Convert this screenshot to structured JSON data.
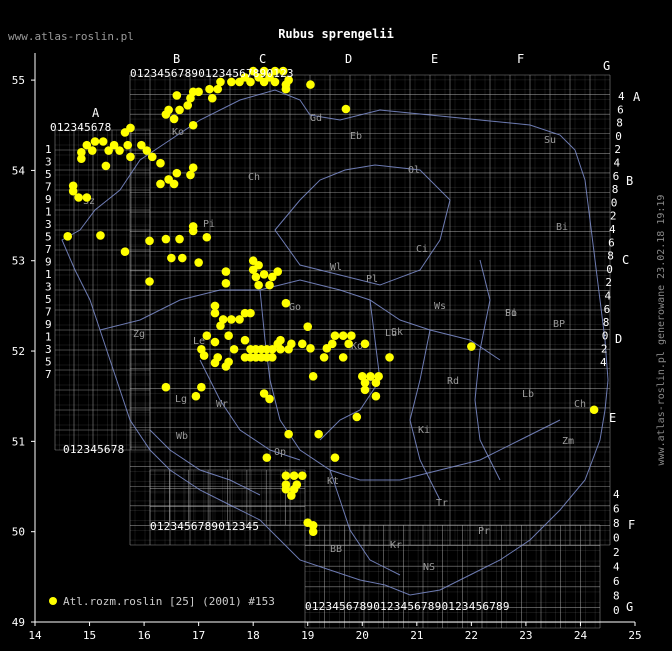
{
  "title": "Rubus sprengelii",
  "site": "www.atlas-roslin.pl",
  "footer": "www.atlas-roslin.pl generowane 23.02.18 19:19",
  "legend": {
    "label": "Atl.rozm.roslin [25] (2001) #153",
    "marker_color": "#ffff00"
  },
  "colors": {
    "background": "#000000",
    "grid": "#b4b4b4",
    "border": "#7f8fd0",
    "point": "#ffff00",
    "axis": "#ffffff",
    "label": "#9a9a9a"
  },
  "axes": {
    "x_ticks": [
      "14",
      "15",
      "16",
      "17",
      "18",
      "19",
      "20",
      "21",
      "22",
      "23",
      "24",
      "25"
    ],
    "y_ticks": [
      "49",
      "50",
      "51",
      "52",
      "53",
      "54",
      "55"
    ],
    "x_range": [
      14,
      25
    ],
    "y_range": [
      49,
      55.3
    ]
  },
  "grid_letters_top": [
    "A",
    "B",
    "C",
    "D",
    "E",
    "F",
    "G"
  ],
  "grid_letters_right": [
    "A",
    "B",
    "C",
    "D",
    "E",
    "F",
    "G"
  ],
  "digit_strip": "0123456789",
  "region_codes": [
    "Gd",
    "Eb",
    "Su",
    "Ol",
    "Ko",
    "Ch",
    "Sz",
    "Bi",
    "Ci",
    "Pi",
    "Wl",
    "Pl",
    "Ws",
    "Go",
    "Po",
    "Lu",
    "Sk",
    "Si",
    "BP",
    "Zg",
    "Le",
    "Ko",
    "Rd",
    "Lb",
    "Ch",
    "Lg",
    "Wr",
    "Cz",
    "Ki",
    "Zm",
    "Wb",
    "Op",
    "Kt",
    "Tr",
    "Pr",
    "NS",
    "BB",
    "Kr"
  ],
  "chart_data": {
    "type": "scatter",
    "xlabel": "",
    "ylabel": "",
    "xlim": [
      14,
      25
    ],
    "ylim": [
      49,
      55.3
    ],
    "series": [
      {
        "name": "Atl.rozm.roslin [25] (2001) #153",
        "points": [
          [
            18.0,
            55.1
          ],
          [
            18.2,
            55.1
          ],
          [
            18.4,
            55.1
          ],
          [
            18.55,
            55.1
          ],
          [
            17.85,
            55.03
          ],
          [
            18.1,
            55.03
          ],
          [
            18.3,
            55.03
          ],
          [
            18.65,
            55.0
          ],
          [
            17.4,
            54.98
          ],
          [
            17.6,
            54.98
          ],
          [
            17.75,
            54.98
          ],
          [
            17.95,
            54.98
          ],
          [
            18.2,
            54.98
          ],
          [
            18.4,
            54.98
          ],
          [
            18.6,
            54.95
          ],
          [
            17.2,
            54.9
          ],
          [
            17.35,
            54.9
          ],
          [
            18.6,
            54.9
          ],
          [
            19.05,
            54.95
          ],
          [
            16.9,
            54.87
          ],
          [
            17.0,
            54.87
          ],
          [
            16.6,
            54.83
          ],
          [
            16.85,
            54.8
          ],
          [
            17.25,
            54.8
          ],
          [
            16.8,
            54.72
          ],
          [
            16.45,
            54.67
          ],
          [
            16.65,
            54.67
          ],
          [
            16.4,
            54.62
          ],
          [
            16.55,
            54.57
          ],
          [
            16.9,
            54.5
          ],
          [
            15.75,
            54.47
          ],
          [
            15.65,
            54.42
          ],
          [
            19.7,
            54.68
          ],
          [
            15.1,
            54.32
          ],
          [
            15.25,
            54.32
          ],
          [
            14.95,
            54.28
          ],
          [
            15.45,
            54.28
          ],
          [
            15.7,
            54.28
          ],
          [
            15.95,
            54.28
          ],
          [
            15.05,
            54.22
          ],
          [
            15.35,
            54.22
          ],
          [
            15.55,
            54.22
          ],
          [
            16.05,
            54.22
          ],
          [
            14.85,
            54.2
          ],
          [
            16.15,
            54.15
          ],
          [
            15.75,
            54.15
          ],
          [
            14.85,
            54.13
          ],
          [
            16.3,
            54.08
          ],
          [
            15.3,
            54.05
          ],
          [
            16.9,
            54.03
          ],
          [
            16.6,
            53.97
          ],
          [
            16.85,
            53.95
          ],
          [
            16.45,
            53.9
          ],
          [
            16.3,
            53.85
          ],
          [
            16.55,
            53.85
          ],
          [
            14.7,
            53.83
          ],
          [
            14.7,
            53.77
          ],
          [
            14.8,
            53.7
          ],
          [
            14.95,
            53.7
          ],
          [
            16.9,
            53.38
          ],
          [
            16.9,
            53.33
          ],
          [
            14.6,
            53.27
          ],
          [
            15.2,
            53.28
          ],
          [
            17.15,
            53.26
          ],
          [
            16.1,
            53.22
          ],
          [
            16.4,
            53.24
          ],
          [
            16.65,
            53.24
          ],
          [
            15.65,
            53.1
          ],
          [
            16.5,
            53.03
          ],
          [
            16.7,
            53.03
          ],
          [
            17.0,
            52.98
          ],
          [
            18.0,
            53.0
          ],
          [
            18.1,
            52.95
          ],
          [
            18.0,
            52.9
          ],
          [
            17.5,
            52.88
          ],
          [
            18.45,
            52.88
          ],
          [
            18.2,
            52.85
          ],
          [
            18.05,
            52.82
          ],
          [
            18.35,
            52.82
          ],
          [
            16.1,
            52.77
          ],
          [
            17.5,
            52.75
          ],
          [
            18.1,
            52.73
          ],
          [
            18.3,
            52.73
          ],
          [
            18.6,
            52.53
          ],
          [
            17.3,
            52.5
          ],
          [
            17.3,
            52.42
          ],
          [
            17.85,
            52.42
          ],
          [
            17.95,
            52.42
          ],
          [
            17.45,
            52.35
          ],
          [
            17.6,
            52.35
          ],
          [
            17.75,
            52.35
          ],
          [
            17.4,
            52.28
          ],
          [
            19.0,
            52.27
          ],
          [
            17.15,
            52.17
          ],
          [
            17.55,
            52.17
          ],
          [
            19.5,
            52.17
          ],
          [
            19.65,
            52.17
          ],
          [
            19.8,
            52.17
          ],
          [
            17.85,
            52.12
          ],
          [
            18.5,
            52.12
          ],
          [
            17.3,
            52.1
          ],
          [
            18.45,
            52.08
          ],
          [
            18.7,
            52.08
          ],
          [
            18.9,
            52.08
          ],
          [
            19.45,
            52.08
          ],
          [
            19.75,
            52.08
          ],
          [
            20.05,
            52.08
          ],
          [
            17.05,
            52.02
          ],
          [
            17.65,
            52.02
          ],
          [
            17.95,
            52.02
          ],
          [
            18.05,
            52.02
          ],
          [
            18.15,
            52.02
          ],
          [
            18.25,
            52.02
          ],
          [
            18.35,
            52.02
          ],
          [
            18.5,
            52.02
          ],
          [
            18.65,
            52.02
          ],
          [
            19.05,
            52.03
          ],
          [
            19.35,
            52.03
          ],
          [
            22.0,
            52.05
          ],
          [
            17.1,
            51.95
          ],
          [
            17.35,
            51.93
          ],
          [
            17.85,
            51.93
          ],
          [
            17.95,
            51.93
          ],
          [
            18.05,
            51.93
          ],
          [
            18.15,
            51.93
          ],
          [
            18.25,
            51.93
          ],
          [
            18.35,
            51.93
          ],
          [
            19.3,
            51.93
          ],
          [
            19.65,
            51.93
          ],
          [
            20.5,
            51.93
          ],
          [
            17.3,
            51.87
          ],
          [
            17.5,
            51.83
          ],
          [
            17.55,
            51.88
          ],
          [
            19.1,
            51.72
          ],
          [
            20.0,
            51.72
          ],
          [
            20.15,
            51.72
          ],
          [
            20.3,
            51.72
          ],
          [
            20.05,
            51.65
          ],
          [
            20.25,
            51.65
          ],
          [
            16.4,
            51.6
          ],
          [
            17.05,
            51.6
          ],
          [
            20.05,
            51.57
          ],
          [
            20.25,
            51.5
          ],
          [
            16.95,
            51.5
          ],
          [
            18.2,
            51.53
          ],
          [
            18.3,
            51.47
          ],
          [
            19.9,
            51.27
          ],
          [
            24.25,
            51.35
          ],
          [
            18.65,
            51.08
          ],
          [
            19.2,
            51.08
          ],
          [
            19.5,
            50.82
          ],
          [
            18.25,
            50.82
          ],
          [
            18.6,
            50.62
          ],
          [
            18.75,
            50.62
          ],
          [
            18.9,
            50.62
          ],
          [
            18.6,
            50.52
          ],
          [
            18.8,
            50.52
          ],
          [
            18.6,
            50.47
          ],
          [
            18.75,
            50.47
          ],
          [
            18.7,
            50.4
          ],
          [
            19.0,
            50.1
          ],
          [
            19.1,
            50.07
          ],
          [
            19.1,
            50.0
          ]
        ]
      }
    ]
  }
}
